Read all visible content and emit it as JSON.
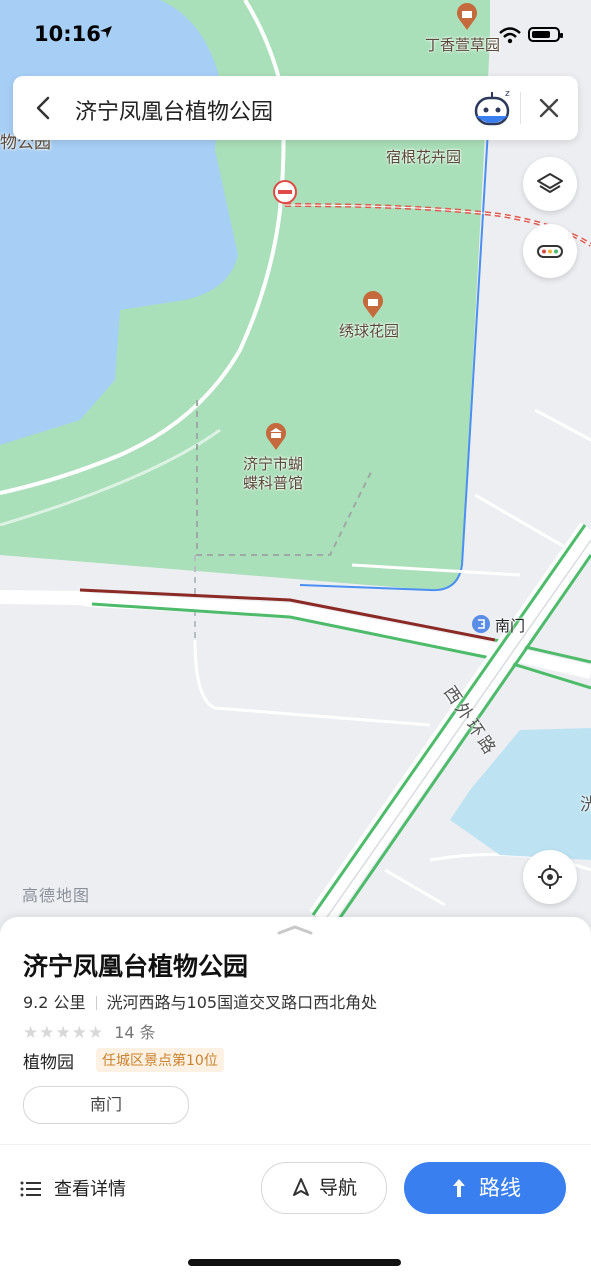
{
  "status_bar": {
    "time": "10:16"
  },
  "search": {
    "query": "济宁凤凰台植物公园"
  },
  "map": {
    "labels": {
      "top_poi": "丁香萱草园",
      "perennial_garden": "宿根花卉园",
      "hydrangea_garden": "绣球花园",
      "butterfly_museum_line1": "济宁市蝴",
      "butterfly_museum_line2": "蝶科普馆",
      "left_partial": "物公园",
      "south_gate": "南门",
      "west_ring_road": "西外环路",
      "right_edge_partial": "洸"
    },
    "watermark": "高德地图",
    "colors": {
      "park": "#a9dfb9",
      "water": "#a7cff5",
      "land": "#eceef2",
      "route_green": "#4dbb6a",
      "route_red": "#8b2a25",
      "boundary": "#4b8ff2"
    }
  },
  "sheet": {
    "title": "济宁凤凰台植物公园",
    "distance": "9.2 公里",
    "address": "洸河西路与105国道交叉路口西北角处",
    "stars": "★★★★★",
    "review_count": "14 条",
    "category": "植物园",
    "rank_badge": "任城区景点第10位",
    "entrance": "南门",
    "details_label": "查看详情",
    "navigate_label": "导航",
    "route_label": "路线"
  }
}
